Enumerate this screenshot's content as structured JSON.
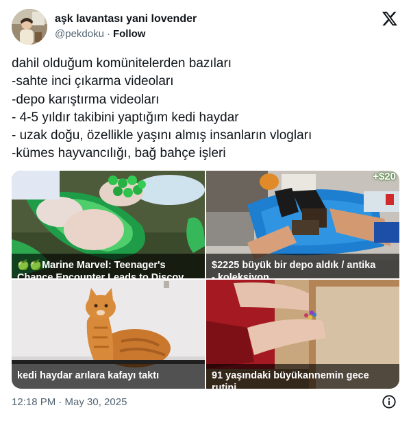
{
  "author": {
    "display_name": "aşk lavantası yani lovender",
    "handle": "@pekdoku",
    "separator": "·",
    "follow_label": "Follow"
  },
  "tweet": {
    "lines": [
      "dahil olduğum komünitelerden bazıları",
      "-sahte inci çıkarma videoları",
      "-depo karıştırma videoları",
      "- 4-5 yıldır takibini yaptığım kedi haydar",
      "- uzak doğu, özellikle yaşını almış insanların vlogları",
      "-kümes hayvancılığı, bağ bahçe işleri"
    ]
  },
  "media": [
    {
      "caption_line1": "🍏🍏Marine Marvel: Teenager's",
      "caption_line2": "Chance Encounter Leads to Discov"
    },
    {
      "caption_line1": "$2225 büyük bir depo aldık /  antika",
      "caption_line2": "- koleksiyon",
      "badge": "+$20"
    },
    {
      "caption_line1": "kedi haydar arılara kafayı taktı",
      "caption_line2": ""
    },
    {
      "caption_line1": "91 yaşındaki büyükannemin gece",
      "caption_line2": "rutini"
    }
  ],
  "footer": {
    "timestamp": "12:18 PM · May 30, 2025"
  },
  "icons": {
    "brand": "x-logo-icon",
    "info": "info-icon"
  }
}
